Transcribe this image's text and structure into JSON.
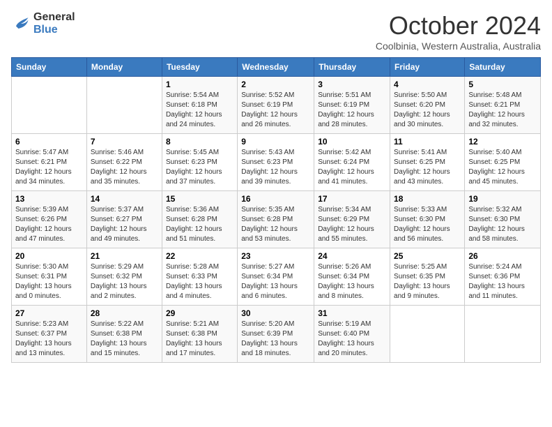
{
  "header": {
    "logo": {
      "general": "General",
      "blue": "Blue"
    },
    "title": "October 2024",
    "subtitle": "Coolbinia, Western Australia, Australia"
  },
  "columns": [
    "Sunday",
    "Monday",
    "Tuesday",
    "Wednesday",
    "Thursday",
    "Friday",
    "Saturday"
  ],
  "weeks": [
    [
      {
        "day": "",
        "info": ""
      },
      {
        "day": "",
        "info": ""
      },
      {
        "day": "1",
        "info": "Sunrise: 5:54 AM\nSunset: 6:18 PM\nDaylight: 12 hours and 24 minutes."
      },
      {
        "day": "2",
        "info": "Sunrise: 5:52 AM\nSunset: 6:19 PM\nDaylight: 12 hours and 26 minutes."
      },
      {
        "day": "3",
        "info": "Sunrise: 5:51 AM\nSunset: 6:19 PM\nDaylight: 12 hours and 28 minutes."
      },
      {
        "day": "4",
        "info": "Sunrise: 5:50 AM\nSunset: 6:20 PM\nDaylight: 12 hours and 30 minutes."
      },
      {
        "day": "5",
        "info": "Sunrise: 5:48 AM\nSunset: 6:21 PM\nDaylight: 12 hours and 32 minutes."
      }
    ],
    [
      {
        "day": "6",
        "info": "Sunrise: 5:47 AM\nSunset: 6:21 PM\nDaylight: 12 hours and 34 minutes."
      },
      {
        "day": "7",
        "info": "Sunrise: 5:46 AM\nSunset: 6:22 PM\nDaylight: 12 hours and 35 minutes."
      },
      {
        "day": "8",
        "info": "Sunrise: 5:45 AM\nSunset: 6:23 PM\nDaylight: 12 hours and 37 minutes."
      },
      {
        "day": "9",
        "info": "Sunrise: 5:43 AM\nSunset: 6:23 PM\nDaylight: 12 hours and 39 minutes."
      },
      {
        "day": "10",
        "info": "Sunrise: 5:42 AM\nSunset: 6:24 PM\nDaylight: 12 hours and 41 minutes."
      },
      {
        "day": "11",
        "info": "Sunrise: 5:41 AM\nSunset: 6:25 PM\nDaylight: 12 hours and 43 minutes."
      },
      {
        "day": "12",
        "info": "Sunrise: 5:40 AM\nSunset: 6:25 PM\nDaylight: 12 hours and 45 minutes."
      }
    ],
    [
      {
        "day": "13",
        "info": "Sunrise: 5:39 AM\nSunset: 6:26 PM\nDaylight: 12 hours and 47 minutes."
      },
      {
        "day": "14",
        "info": "Sunrise: 5:37 AM\nSunset: 6:27 PM\nDaylight: 12 hours and 49 minutes."
      },
      {
        "day": "15",
        "info": "Sunrise: 5:36 AM\nSunset: 6:28 PM\nDaylight: 12 hours and 51 minutes."
      },
      {
        "day": "16",
        "info": "Sunrise: 5:35 AM\nSunset: 6:28 PM\nDaylight: 12 hours and 53 minutes."
      },
      {
        "day": "17",
        "info": "Sunrise: 5:34 AM\nSunset: 6:29 PM\nDaylight: 12 hours and 55 minutes."
      },
      {
        "day": "18",
        "info": "Sunrise: 5:33 AM\nSunset: 6:30 PM\nDaylight: 12 hours and 56 minutes."
      },
      {
        "day": "19",
        "info": "Sunrise: 5:32 AM\nSunset: 6:30 PM\nDaylight: 12 hours and 58 minutes."
      }
    ],
    [
      {
        "day": "20",
        "info": "Sunrise: 5:30 AM\nSunset: 6:31 PM\nDaylight: 13 hours and 0 minutes."
      },
      {
        "day": "21",
        "info": "Sunrise: 5:29 AM\nSunset: 6:32 PM\nDaylight: 13 hours and 2 minutes."
      },
      {
        "day": "22",
        "info": "Sunrise: 5:28 AM\nSunset: 6:33 PM\nDaylight: 13 hours and 4 minutes."
      },
      {
        "day": "23",
        "info": "Sunrise: 5:27 AM\nSunset: 6:34 PM\nDaylight: 13 hours and 6 minutes."
      },
      {
        "day": "24",
        "info": "Sunrise: 5:26 AM\nSunset: 6:34 PM\nDaylight: 13 hours and 8 minutes."
      },
      {
        "day": "25",
        "info": "Sunrise: 5:25 AM\nSunset: 6:35 PM\nDaylight: 13 hours and 9 minutes."
      },
      {
        "day": "26",
        "info": "Sunrise: 5:24 AM\nSunset: 6:36 PM\nDaylight: 13 hours and 11 minutes."
      }
    ],
    [
      {
        "day": "27",
        "info": "Sunrise: 5:23 AM\nSunset: 6:37 PM\nDaylight: 13 hours and 13 minutes."
      },
      {
        "day": "28",
        "info": "Sunrise: 5:22 AM\nSunset: 6:38 PM\nDaylight: 13 hours and 15 minutes."
      },
      {
        "day": "29",
        "info": "Sunrise: 5:21 AM\nSunset: 6:38 PM\nDaylight: 13 hours and 17 minutes."
      },
      {
        "day": "30",
        "info": "Sunrise: 5:20 AM\nSunset: 6:39 PM\nDaylight: 13 hours and 18 minutes."
      },
      {
        "day": "31",
        "info": "Sunrise: 5:19 AM\nSunset: 6:40 PM\nDaylight: 13 hours and 20 minutes."
      },
      {
        "day": "",
        "info": ""
      },
      {
        "day": "",
        "info": ""
      }
    ]
  ]
}
